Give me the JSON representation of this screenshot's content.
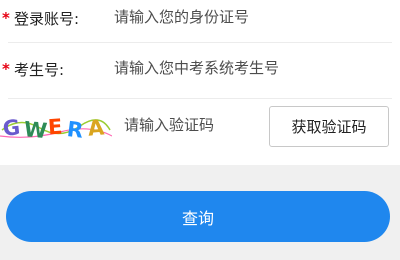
{
  "form": {
    "account": {
      "required_mark": "*",
      "label": "登录账号:",
      "placeholder": "请输入您的身份证号"
    },
    "exam_number": {
      "required_mark": "*",
      "label": "考生号:",
      "placeholder": "请输入您中考系统考生号"
    },
    "captcha": {
      "image_text": "GWERA",
      "placeholder": "请输入验证码",
      "get_code_label": "获取验证码"
    }
  },
  "actions": {
    "query_label": "查询"
  },
  "colors": {
    "required": "#e60012",
    "primary_button": "#1f87ee",
    "page_background": "#f0f0f0"
  }
}
